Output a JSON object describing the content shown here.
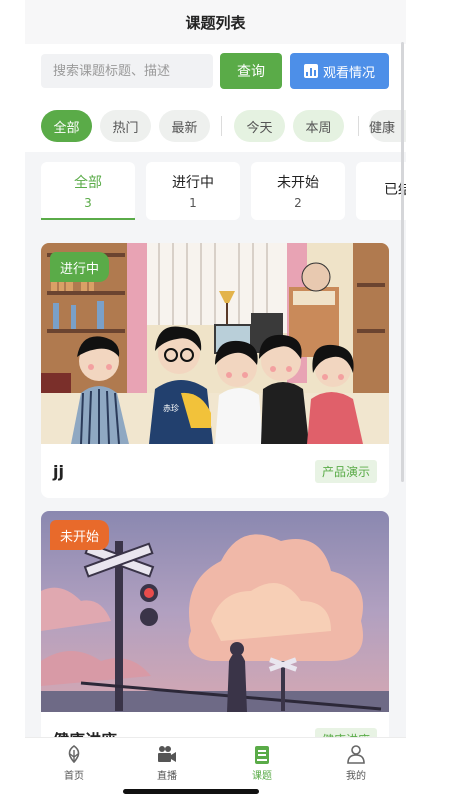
{
  "header": {
    "title": "课题列表"
  },
  "search": {
    "placeholder": "搜索课题标题、描述",
    "value": ""
  },
  "actions": {
    "query_label": "查询",
    "watch_label": "观看情况",
    "watch_icon": "bar-chart-icon"
  },
  "filters": [
    {
      "label": "全部",
      "active": true
    },
    {
      "label": "热门"
    },
    {
      "label": "最新"
    },
    {
      "label": "今天"
    },
    {
      "label": "本周"
    },
    {
      "label": "健康"
    }
  ],
  "status_tabs": [
    {
      "label": "全部",
      "count": "3",
      "active": true
    },
    {
      "label": "进行中",
      "count": "1"
    },
    {
      "label": "未开始",
      "count": "2"
    },
    {
      "label": "已结束",
      "count": ""
    }
  ],
  "cards": [
    {
      "badge": "进行中",
      "badge_color": "#5aab48",
      "title": "jj",
      "tag": "产品演示",
      "image": "illustration-friends-in-room",
      "image_text": "赤珍"
    },
    {
      "badge": "未开始",
      "badge_color": "#e86a2b",
      "title": "健康讲座",
      "tag": "健康讲座",
      "image": "illustration-railway-crossing-sunset"
    }
  ],
  "tabbar": [
    {
      "label": "首页",
      "icon": "home-icon"
    },
    {
      "label": "直播",
      "icon": "live-camera-icon"
    },
    {
      "label": "课题",
      "icon": "book-icon",
      "active": true
    },
    {
      "label": "我的",
      "icon": "user-icon"
    }
  ],
  "colors": {
    "accent": "#5aab48",
    "blue": "#4d8fe8",
    "orange": "#e86a2b"
  }
}
